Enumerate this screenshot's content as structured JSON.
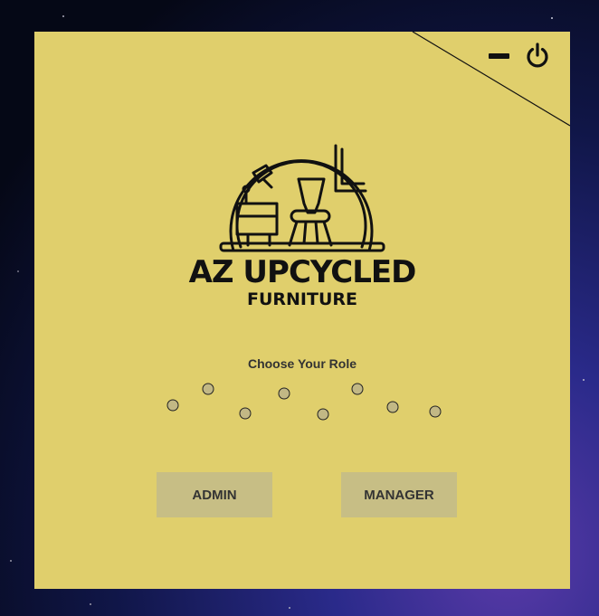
{
  "window": {
    "minimize_icon": "minimize-icon",
    "power_icon": "power-icon"
  },
  "brand": {
    "name": "AZ UPCYCLED",
    "subtitle": "FURNITURE",
    "logo_icon": "furniture-logo-icon"
  },
  "role_prompt": "Choose Your Role",
  "loading_indicator": {
    "dot_count": 8
  },
  "buttons": {
    "admin": "ADMIN",
    "manager": "MANAGER"
  },
  "colors": {
    "panel": "#e0cf6c",
    "button": "#c7be85",
    "text": "#111111"
  }
}
